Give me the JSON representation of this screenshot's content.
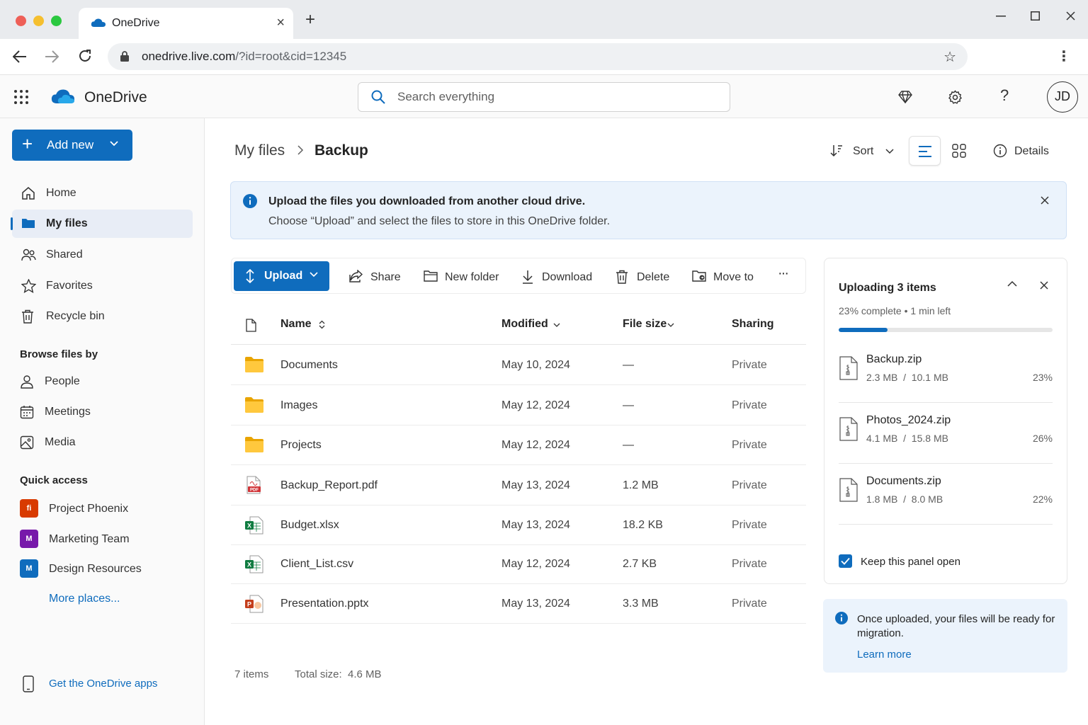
{
  "browser": {
    "tab_title": "OneDrive",
    "url_main": "onedrive.live.com",
    "url_rest": "/?id=root&cid=12345"
  },
  "app": {
    "name": "OneDrive",
    "search_placeholder": "Search everything",
    "avatar_initials": "JD",
    "brand_color": "#0f6cbd"
  },
  "sidebar": {
    "add_new": "Add new",
    "nav": [
      {
        "label": "Home",
        "icon": "home-icon"
      },
      {
        "label": "My files",
        "icon": "folder-icon",
        "active": true
      },
      {
        "label": "Shared",
        "icon": "people-icon"
      },
      {
        "label": "Favorites",
        "icon": "star-icon"
      },
      {
        "label": "Recycle bin",
        "icon": "trash-icon"
      }
    ],
    "browse_header": "Browse files by",
    "browse": [
      {
        "label": "People",
        "icon": "person-icon"
      },
      {
        "label": "Meetings",
        "icon": "calendar-icon"
      },
      {
        "label": "Media",
        "icon": "image-icon"
      }
    ],
    "quick_header": "Quick access",
    "quick": [
      {
        "label": "Project Phoenix",
        "badge": "fi",
        "color": "#d83b01"
      },
      {
        "label": "Marketing Team",
        "badge": "M",
        "color": "#7719aa"
      },
      {
        "label": "Design Resources",
        "badge": "M",
        "color": "#0f6cbd"
      }
    ],
    "more_places": "More places...",
    "get_apps": "Get the OneDrive apps"
  },
  "main": {
    "breadcrumb": [
      "My files",
      "Backup"
    ],
    "sort_label": "Sort",
    "details_label": "Details",
    "info": {
      "title": "Upload the files you downloaded from another cloud drive.",
      "body": "Choose “Upload” and select the files to store in this OneDrive folder."
    },
    "commands": {
      "upload": "Upload",
      "share": "Share",
      "new_folder": "New folder",
      "download": "Download",
      "delete": "Delete",
      "move_to": "Move to",
      "more": "···"
    },
    "columns": {
      "name": "Name",
      "modified": "Modified",
      "size": "File size",
      "sharing": "Sharing"
    },
    "rows": [
      {
        "name": "Documents",
        "type": "folder",
        "modified": "May 10, 2024",
        "size": "—",
        "sharing": "Private"
      },
      {
        "name": "Images",
        "type": "folder",
        "modified": "May 12, 2024",
        "size": "—",
        "sharing": "Private"
      },
      {
        "name": "Projects",
        "type": "folder",
        "modified": "May 12, 2024",
        "size": "—",
        "sharing": "Private"
      },
      {
        "name": "Backup_Report.pdf",
        "type": "pdf",
        "modified": "May 13, 2024",
        "size": "1.2 MB",
        "sharing": "Private"
      },
      {
        "name": "Budget.xlsx",
        "type": "excel",
        "modified": "May 13, 2024",
        "size": "18.2 KB",
        "sharing": "Private"
      },
      {
        "name": "Client_List.csv",
        "type": "excel",
        "modified": "May 12, 2024",
        "size": "2.7 KB",
        "sharing": "Private"
      },
      {
        "name": "Presentation.pptx",
        "type": "powerpoint",
        "modified": "May 13, 2024",
        "size": "3.3 MB",
        "sharing": "Private"
      }
    ],
    "item_count": "7 items",
    "total_size": "Total size:  4.6 MB"
  },
  "upload_panel": {
    "title": "Uploading 3 items",
    "status": "23% complete • 1 min left",
    "progress": 0.23,
    "items": [
      {
        "name": "Backup.zip",
        "size": "2.3 MB  /  10.1 MB",
        "pct": "23%"
      },
      {
        "name": "Photos_2024.zip",
        "size": "4.1 MB  /  15.8 MB",
        "pct": "26%"
      },
      {
        "name": "Documents.zip",
        "size": "1.8 MB  /  8.0 MB",
        "pct": "22%"
      }
    ],
    "keep_open": "Keep this panel open",
    "keep_open_checked": true
  },
  "info_card": {
    "text": "Once uploaded, your files will be ready for migration.",
    "link": "Learn more"
  }
}
